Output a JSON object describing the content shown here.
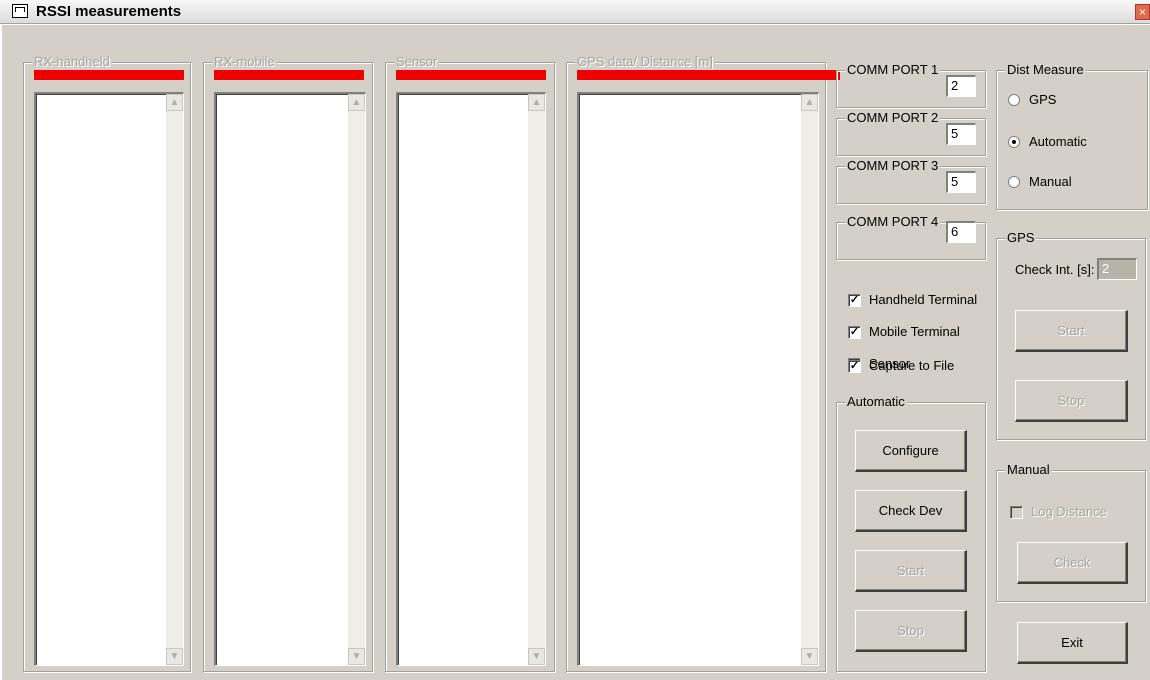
{
  "window": {
    "title": "RSSI measurements",
    "close_glyph": "×"
  },
  "panels": {
    "rx_handheld": {
      "label": "RX-handheld"
    },
    "rx_mobile": {
      "label": "RX-mobile"
    },
    "sensor": {
      "label": "Sensor"
    },
    "gps_data": {
      "label": "GPS data/ Distance [m]"
    }
  },
  "comm_ports": [
    {
      "label": "COMM PORT 1",
      "value": "2"
    },
    {
      "label": "COMM PORT 2",
      "value": "5"
    },
    {
      "label": "COMM PORT 3",
      "value": "5"
    },
    {
      "label": "COMM PORT 4",
      "value": "6"
    }
  ],
  "terminals": [
    {
      "label": "Handheld Terminal",
      "checked": true
    },
    {
      "label": "Mobile Terminal",
      "checked": true
    },
    {
      "label": "Sensor",
      "checked": true
    },
    {
      "label": "Capture to File",
      "checked": true
    }
  ],
  "automatic": {
    "label": "Automatic",
    "configure": "Configure",
    "check_dev": "Check Dev",
    "start": "Start",
    "stop": "Stop"
  },
  "dist_measure": {
    "label": "Dist Measure",
    "options": [
      "GPS",
      "Automatic",
      "Manual"
    ],
    "selected": "Automatic"
  },
  "gps": {
    "label": "GPS",
    "check_int_label": "Check Int. [s]:",
    "check_int_value": "2",
    "start": "Start",
    "stop": "Stop"
  },
  "manual": {
    "label": "Manual",
    "log_distance": "Log Distance",
    "check": "Check"
  },
  "exit": "Exit",
  "colors": {
    "signal_bar": "#ee0000",
    "window_bg": "#d4d0c8"
  }
}
